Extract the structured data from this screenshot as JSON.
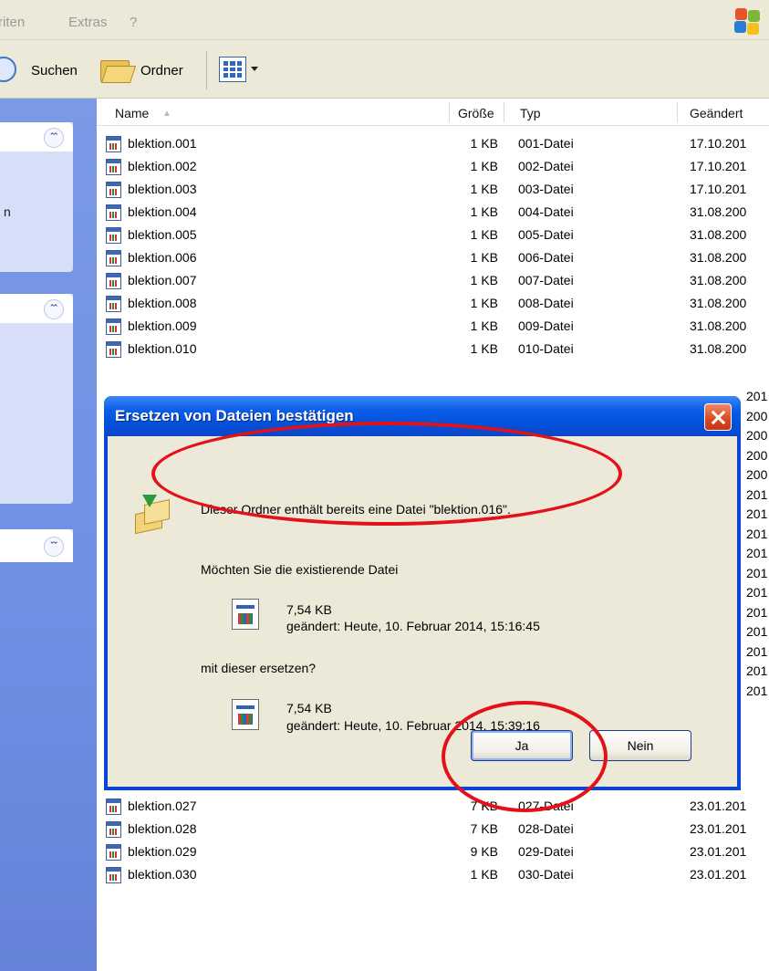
{
  "menu": {
    "items": [
      "riten",
      "Extras",
      "?"
    ]
  },
  "toolbar": {
    "search_label": "Suchen",
    "folders_label": "Ordner"
  },
  "columns": {
    "name": "Name",
    "size": "Größe",
    "type": "Typ",
    "modified": "Geändert"
  },
  "files_top": [
    {
      "name": "blektion.001",
      "size": "1 KB",
      "type": "001-Datei",
      "date": "17.10.201"
    },
    {
      "name": "blektion.002",
      "size": "1 KB",
      "type": "002-Datei",
      "date": "17.10.201"
    },
    {
      "name": "blektion.003",
      "size": "1 KB",
      "type": "003-Datei",
      "date": "17.10.201"
    },
    {
      "name": "blektion.004",
      "size": "1 KB",
      "type": "004-Datei",
      "date": "31.08.200"
    },
    {
      "name": "blektion.005",
      "size": "1 KB",
      "type": "005-Datei",
      "date": "31.08.200"
    },
    {
      "name": "blektion.006",
      "size": "1 KB",
      "type": "006-Datei",
      "date": "31.08.200"
    },
    {
      "name": "blektion.007",
      "size": "1 KB",
      "type": "007-Datei",
      "date": "31.08.200"
    },
    {
      "name": "blektion.008",
      "size": "1 KB",
      "type": "008-Datei",
      "date": "31.08.200"
    },
    {
      "name": "blektion.009",
      "size": "1 KB",
      "type": "009-Datei",
      "date": "31.08.200"
    },
    {
      "name": "blektion.010",
      "size": "1 KB",
      "type": "010-Datei",
      "date": "31.08.200"
    }
  ],
  "files_bottom": [
    {
      "name": "blektion.027",
      "size": "7 KB",
      "type": "027-Datei",
      "date": "23.01.201"
    },
    {
      "name": "blektion.028",
      "size": "7 KB",
      "type": "028-Datei",
      "date": "23.01.201"
    },
    {
      "name": "blektion.029",
      "size": "9 KB",
      "type": "029-Datei",
      "date": "23.01.201"
    },
    {
      "name": "blektion.030",
      "size": "1 KB",
      "type": "030-Datei",
      "date": "23.01.201"
    }
  ],
  "right_edge_dates": [
    "201",
    "200",
    "200",
    "200",
    "200",
    "201",
    "201",
    "201",
    "201",
    "201",
    "201",
    "201",
    "201",
    "201",
    "201",
    "201"
  ],
  "dialog": {
    "title": "Ersetzen von Dateien bestätigen",
    "message": "Dieser Ordner enthält bereits eine Datei \"blektion.016\".",
    "question": "Möchten Sie die existierende Datei",
    "existing": {
      "size": "7,54 KB",
      "modified": "geändert: Heute, 10. Februar 2014, 15:16:45"
    },
    "replace_with": "mit dieser ersetzen?",
    "new": {
      "size": "7,54 KB",
      "modified": "geändert: Heute, 10. Februar 2014, 15:39:16"
    },
    "yes_label": "Ja",
    "no_label": "Nein"
  },
  "highlight_color": "#e3121a"
}
